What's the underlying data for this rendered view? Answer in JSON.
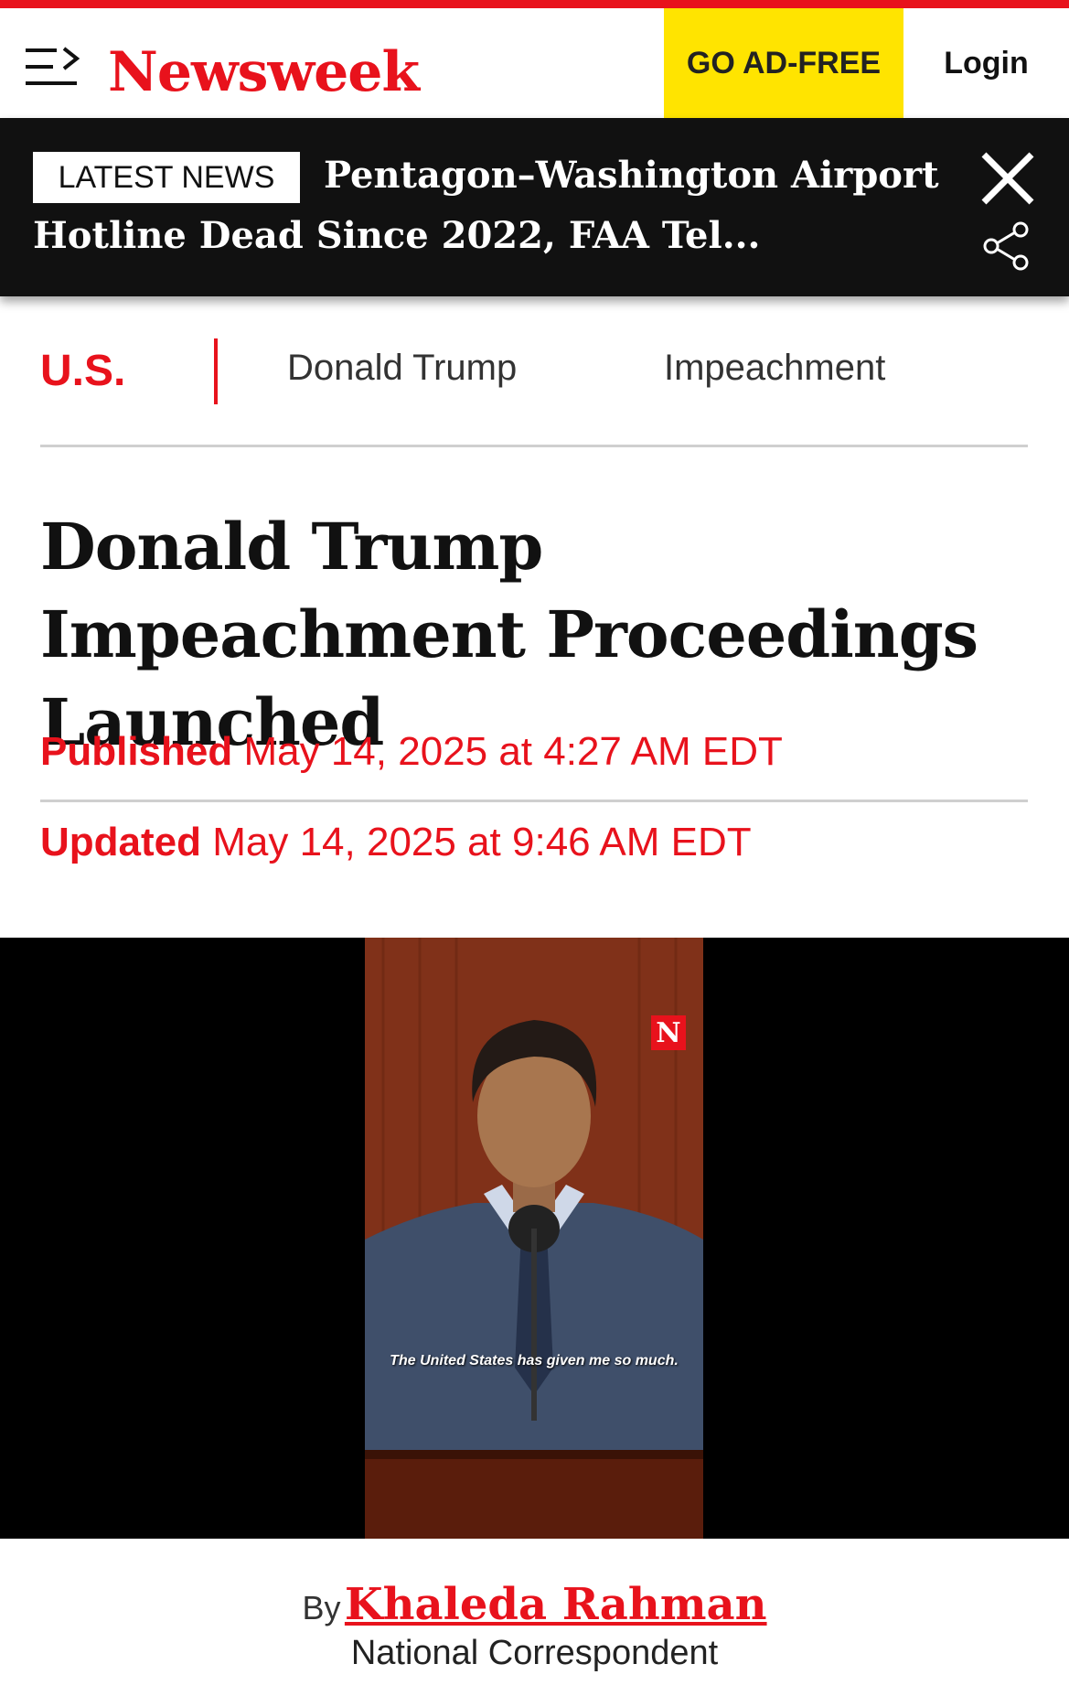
{
  "header": {
    "logo": "Newsweek",
    "ad_free_label": "GO AD-FREE",
    "login_label": "Login"
  },
  "ticker": {
    "badge": "LATEST NEWS",
    "headline": "Pentagon–Washington Airport Hotline Dead Since 2022, FAA Tel..."
  },
  "tags": {
    "primary": "U.S.",
    "items": [
      "Donald Trump",
      "Impeachment"
    ]
  },
  "article": {
    "title": "Donald Trump Impeachment Proceedings Launched",
    "published_label": "Published",
    "published_date": "May 14, 2025 at 4:27 AM EDT",
    "updated_label": "Updated",
    "updated_date": "May 14, 2025 at 9:46 AM EDT"
  },
  "video": {
    "badge": "N",
    "caption": "The United States has given me so much."
  },
  "byline": {
    "by_label": "By",
    "author": "Khaleda Rahman",
    "role": "National Correspondent"
  },
  "colors": {
    "brand_red": "#e8121c",
    "ad_yellow": "#ffe400",
    "ticker_bg": "#111111"
  }
}
